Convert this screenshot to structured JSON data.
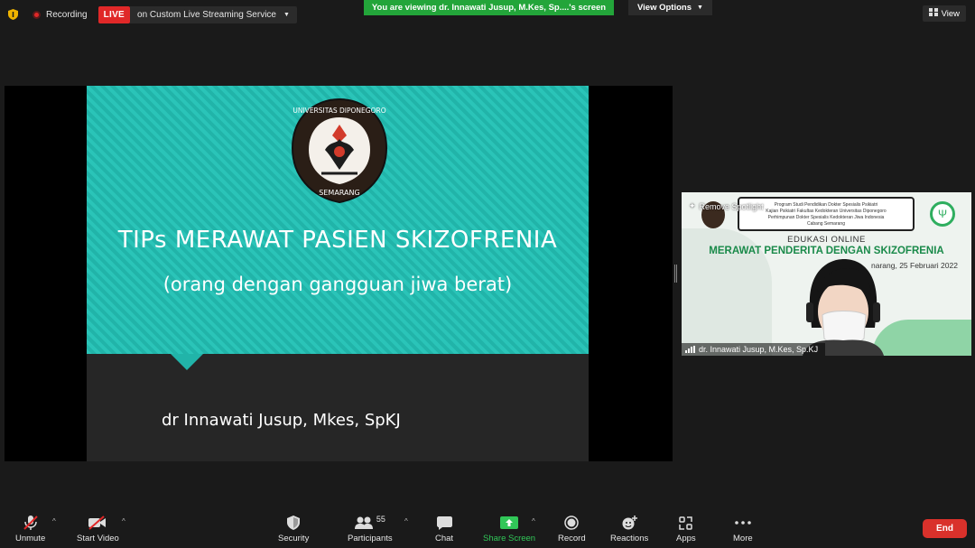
{
  "top_bar": {
    "recording_label": "Recording",
    "live_badge": "LIVE",
    "stream_service": "on Custom Live Streaming Service",
    "viewing_banner": "You are viewing dr. Innawati Jusup, M.Kes, Sp....'s screen",
    "view_options": "View Options",
    "view_button": "View"
  },
  "slide": {
    "logo_top_text": "UNIVERSITAS DIPONEGORO",
    "logo_bottom_text": "SEMARANG",
    "title": "TIPs  MERAWAT  PASIEN SKIZOFRENIA",
    "subtitle": "(orang dengan gangguan jiwa berat)",
    "author": "dr Innawati Jusup, Mkes, SpKJ"
  },
  "video": {
    "spotlight_label": "Remove Spotlight",
    "header_lines": [
      "Program Studi Pendidikan Dokter Spesialis Psikiatri",
      "Kajian Psikiatri Fakultas Kedokteran Universitas Diponegoro",
      "Perhimpunan Dokter Spesialis Kedokteran Jiwa Indonesia",
      "Cabang Semarang"
    ],
    "edu_label": "EDUKASI ONLINE",
    "title": "MERAWAT PENDERITA DENGAN SKIZOFRENIA",
    "date": "narang, 25 Februari 2022",
    "participant_name": "dr. Innawati Jusup, M.Kes, Sp.KJ"
  },
  "toolbar": {
    "unmute": "Unmute",
    "start_video": "Start Video",
    "security": "Security",
    "participants": "Participants",
    "participants_count": "55",
    "chat": "Chat",
    "share_screen": "Share Screen",
    "record": "Record",
    "reactions": "Reactions",
    "apps": "Apps",
    "more": "More",
    "end": "End"
  },
  "colors": {
    "live_red": "#e02828",
    "banner_green": "#23a53a",
    "slide_teal": "#2ac4b8",
    "share_green": "#31c758",
    "end_red": "#d9312b"
  }
}
